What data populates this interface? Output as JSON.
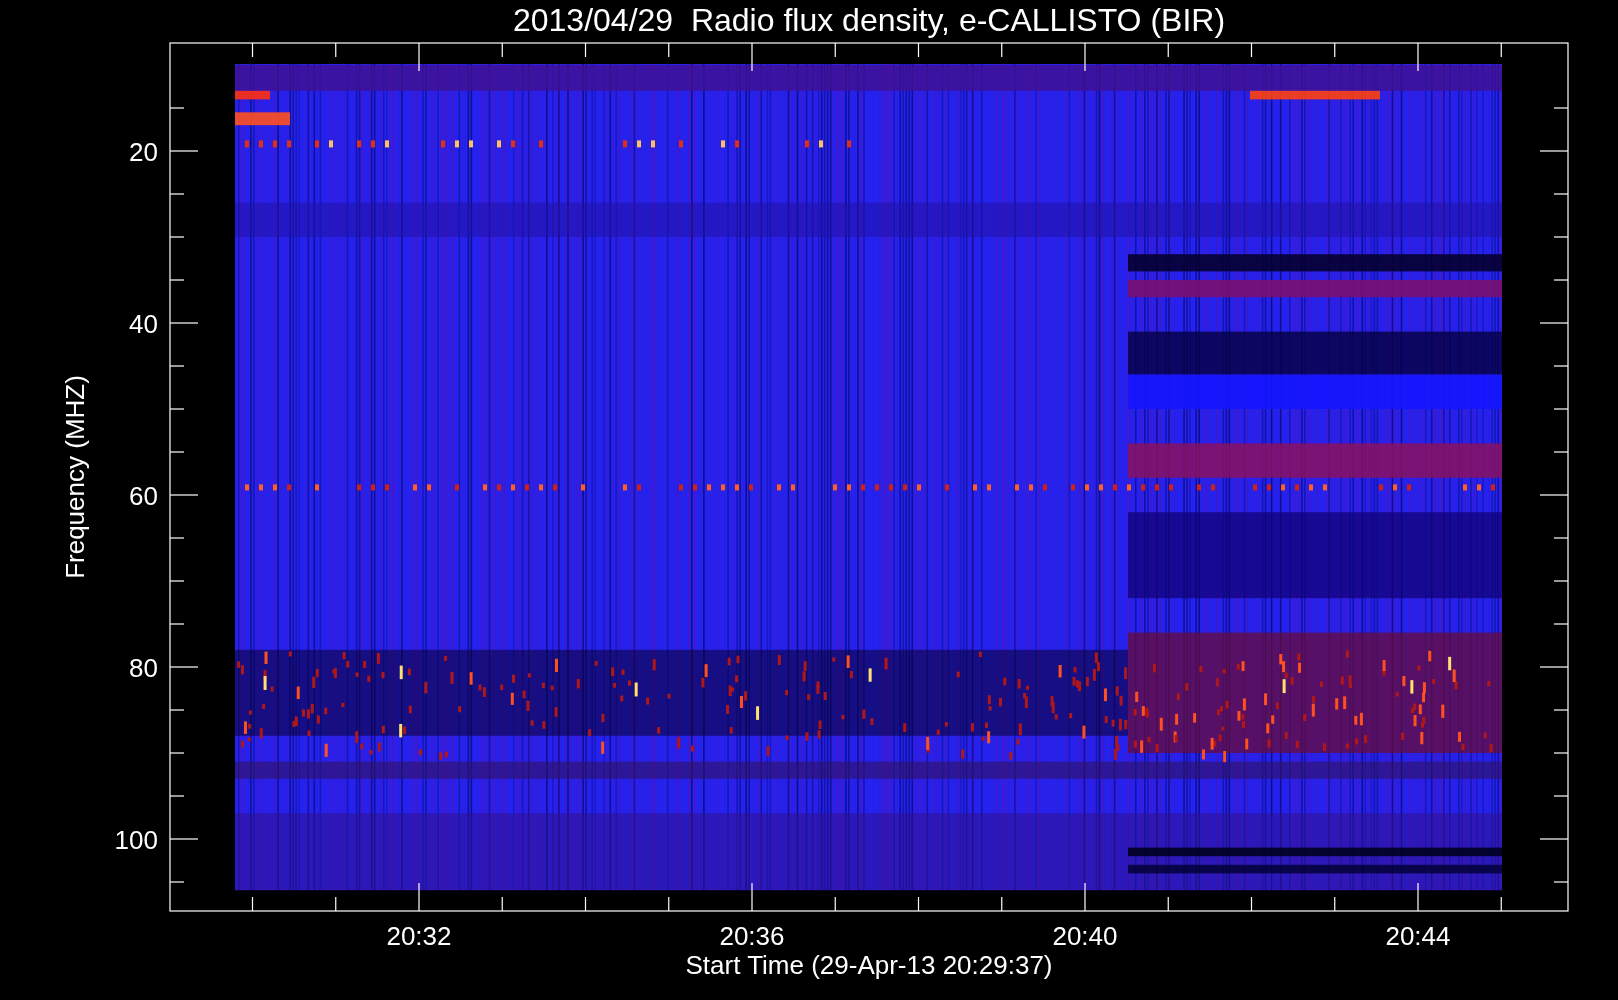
{
  "plot": {
    "title": "2013/04/29  Radio flux density, e-CALLISTO (BIR)",
    "y_axis": {
      "label": "Frequency (MHZ)",
      "ticks": [
        "20",
        "40",
        "60",
        "80",
        "100"
      ]
    },
    "x_axis": {
      "label": "Start Time (29-Apr-13 20:29:37)",
      "ticks": [
        "20:32",
        "20:36",
        "20:40",
        "20:44"
      ]
    }
  }
}
